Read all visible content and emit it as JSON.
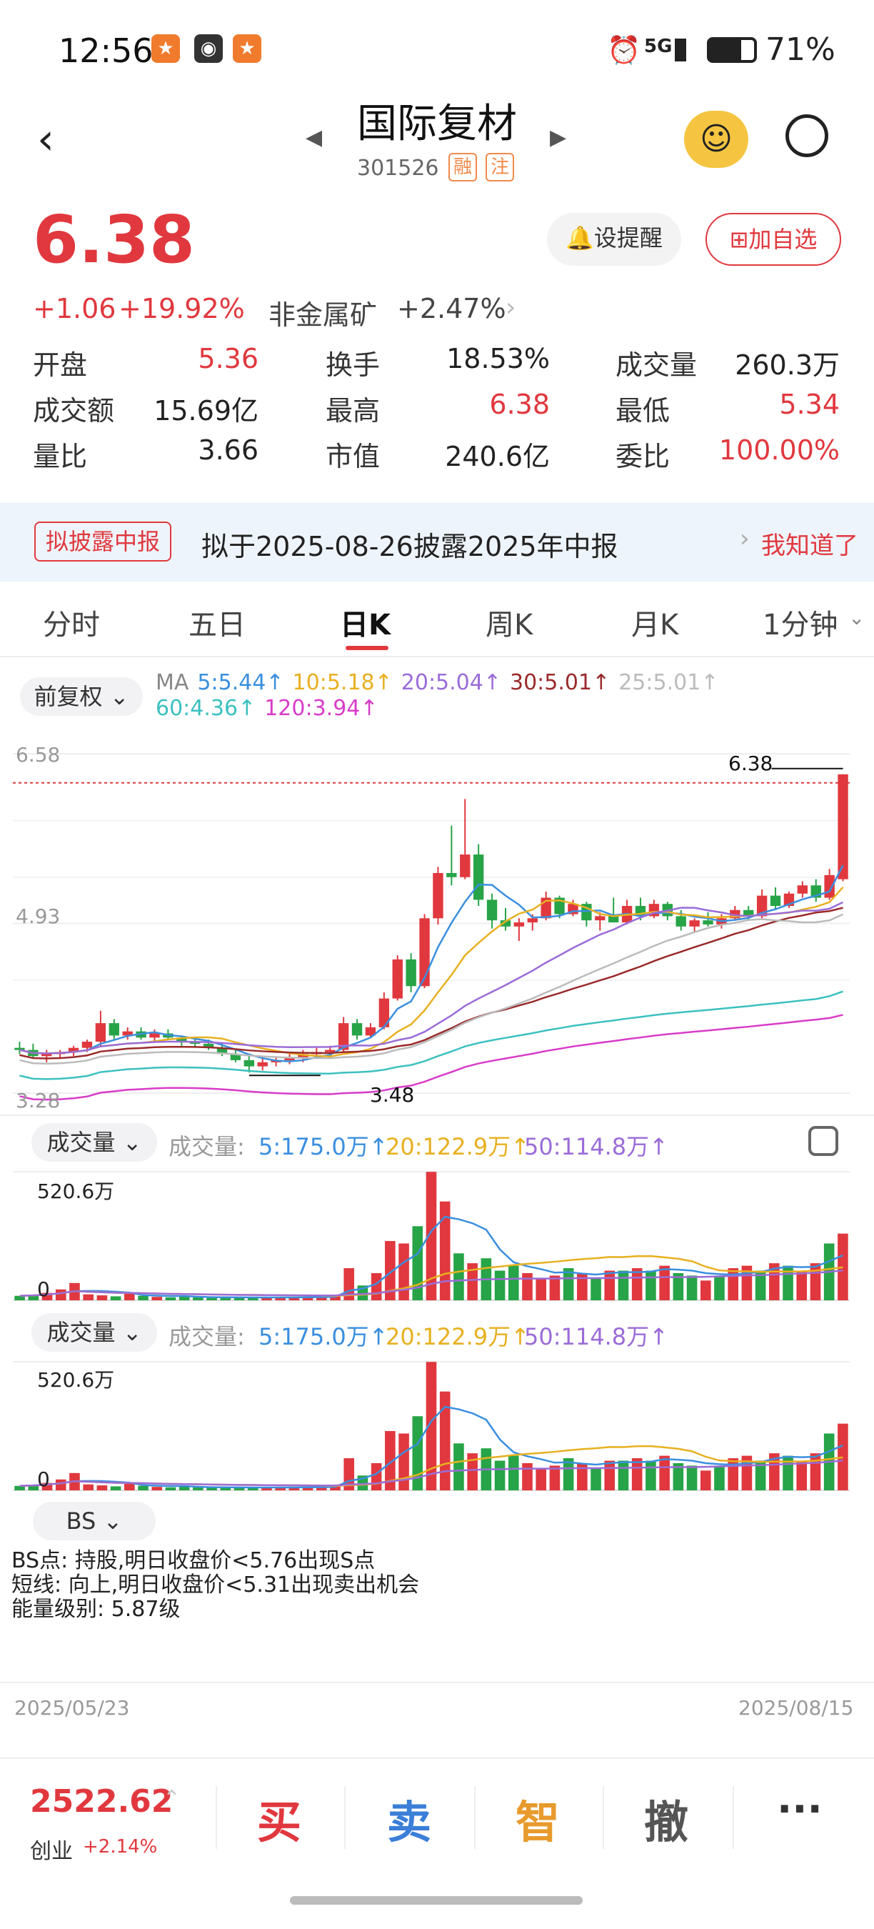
{
  "status": {
    "time": "12:56",
    "battery": "71%",
    "signal": "5G"
  },
  "header": {
    "title": "国际复材",
    "code": "301526",
    "tag1": "融",
    "tag2": "注"
  },
  "quote": {
    "price": "6.38",
    "change": "+1.06",
    "change_pct": "+19.92%",
    "sector": "非金属矿",
    "sector_pct": "+2.47%",
    "alert_btn": "设提醒",
    "watch_btn": "加自选",
    "rows": [
      [
        {
          "l": "开盘",
          "v": "5.36"
        },
        {
          "l": "换手",
          "v": "18.53%"
        },
        {
          "l": "成交量",
          "v": "260.3万"
        }
      ],
      [
        {
          "l": "成交额",
          "v": "15.69亿"
        },
        {
          "l": "最高",
          "v": "6.38"
        },
        {
          "l": "最低",
          "v": "5.34"
        }
      ],
      [
        {
          "l": "量比",
          "v": "3.66"
        },
        {
          "l": "市值",
          "v": "240.6亿"
        },
        {
          "l": "委比",
          "v": "100.00%"
        }
      ]
    ]
  },
  "banner": {
    "tag": "拟披露中报",
    "text": "拟于2025-08-26披露2025年中报",
    "action": "我知道了"
  },
  "tabs": [
    "分时",
    "五日",
    "日K",
    "周K",
    "月K",
    "1分钟"
  ],
  "ma": {
    "mode": "前复权",
    "items": [
      {
        "t": "MA",
        "c": "#888"
      },
      {
        "t": "5:5.44↑",
        "c": "#3b8fde"
      },
      {
        "t": "10:5.18↑",
        "c": "#e8b020"
      },
      {
        "t": "20:5.04↑",
        "c": "#9b6cd8"
      },
      {
        "t": "30:5.01↑",
        "c": "#9a2b2b"
      },
      {
        "t": "25:5.01↑",
        "c": "#bbbbbb"
      },
      {
        "t": "60:4.36↑",
        "c": "#3cc0c0"
      },
      {
        "t": "120:3.94↑",
        "c": "#d83cc8"
      }
    ]
  },
  "chart": {
    "top_label": "6.58",
    "mid_label": "4.93",
    "low_label": "3.28",
    "hi_mark": "6.38",
    "lo_mark": "3.48",
    "ylim": [
      3.28,
      6.58
    ],
    "candles": [
      [
        3.72,
        3.78,
        3.66,
        3.7
      ],
      [
        3.7,
        3.76,
        3.62,
        3.64
      ],
      [
        3.64,
        3.7,
        3.58,
        3.66
      ],
      [
        3.66,
        3.7,
        3.62,
        3.68
      ],
      [
        3.68,
        3.74,
        3.64,
        3.72
      ],
      [
        3.72,
        3.8,
        3.68,
        3.78
      ],
      [
        3.78,
        4.08,
        3.74,
        3.96
      ],
      [
        3.96,
        4.0,
        3.8,
        3.84
      ],
      [
        3.84,
        3.92,
        3.8,
        3.88
      ],
      [
        3.88,
        3.92,
        3.8,
        3.82
      ],
      [
        3.82,
        3.9,
        3.78,
        3.86
      ],
      [
        3.86,
        3.9,
        3.8,
        3.82
      ],
      [
        3.82,
        3.84,
        3.74,
        3.78
      ],
      [
        3.78,
        3.82,
        3.72,
        3.76
      ],
      [
        3.76,
        3.8,
        3.7,
        3.72
      ],
      [
        3.72,
        3.76,
        3.64,
        3.66
      ],
      [
        3.66,
        3.7,
        3.58,
        3.6
      ],
      [
        3.6,
        3.64,
        3.48,
        3.54
      ],
      [
        3.54,
        3.62,
        3.5,
        3.58
      ],
      [
        3.58,
        3.64,
        3.54,
        3.6
      ],
      [
        3.6,
        3.66,
        3.56,
        3.62
      ],
      [
        3.62,
        3.7,
        3.58,
        3.66
      ],
      [
        3.66,
        3.72,
        3.62,
        3.68
      ],
      [
        3.68,
        3.74,
        3.62,
        3.7
      ],
      [
        3.7,
        4.02,
        3.68,
        3.96
      ],
      [
        3.96,
        4.0,
        3.8,
        3.84
      ],
      [
        3.84,
        3.96,
        3.82,
        3.92
      ],
      [
        3.92,
        4.26,
        3.9,
        4.2
      ],
      [
        4.2,
        4.62,
        4.18,
        4.58
      ],
      [
        4.58,
        4.64,
        4.26,
        4.32
      ],
      [
        4.32,
        5.02,
        4.3,
        4.98
      ],
      [
        4.98,
        5.48,
        4.92,
        5.42
      ],
      [
        5.42,
        5.88,
        5.3,
        5.38
      ],
      [
        5.38,
        6.14,
        5.36,
        5.6
      ],
      [
        5.6,
        5.7,
        5.1,
        5.16
      ],
      [
        5.16,
        5.22,
        4.88,
        4.96
      ],
      [
        4.96,
        5.08,
        4.86,
        4.9
      ],
      [
        4.9,
        4.98,
        4.76,
        4.94
      ],
      [
        4.94,
        5.02,
        4.86,
        4.98
      ],
      [
        4.98,
        5.24,
        4.96,
        5.18
      ],
      [
        5.18,
        5.2,
        4.98,
        5.02
      ],
      [
        5.02,
        5.16,
        5.0,
        5.12
      ],
      [
        5.12,
        5.14,
        4.9,
        4.96
      ],
      [
        4.96,
        5.04,
        4.86,
        5.0
      ],
      [
        5.0,
        5.18,
        4.96,
        4.94
      ],
      [
        4.94,
        5.16,
        4.92,
        5.1
      ],
      [
        5.1,
        5.18,
        4.96,
        5.0
      ],
      [
        5.0,
        5.16,
        4.98,
        5.12
      ],
      [
        5.12,
        5.14,
        4.96,
        5.0
      ],
      [
        5.0,
        5.06,
        4.86,
        4.9
      ],
      [
        4.9,
        4.98,
        4.84,
        4.96
      ],
      [
        4.96,
        5.04,
        4.9,
        4.92
      ],
      [
        4.92,
        5.02,
        4.88,
        4.98
      ],
      [
        4.98,
        5.1,
        4.96,
        5.06
      ],
      [
        5.06,
        5.1,
        4.96,
        5.0
      ],
      [
        5.0,
        5.26,
        4.98,
        5.2
      ],
      [
        5.2,
        5.28,
        5.06,
        5.1
      ],
      [
        5.1,
        5.24,
        5.08,
        5.22
      ],
      [
        5.22,
        5.34,
        5.18,
        5.3
      ],
      [
        5.3,
        5.36,
        5.14,
        5.18
      ],
      [
        5.18,
        5.46,
        5.16,
        5.4
      ],
      [
        5.36,
        6.38,
        5.34,
        6.38
      ]
    ]
  },
  "volume": {
    "label": "成交量",
    "ma_label": "成交量:",
    "ma5": "5:175.0万↑",
    "ma20": "20:122.9万↑",
    "ma50": "50:114.8万↑",
    "max_label": "520.6万",
    "zero": "0",
    "max": 520.6,
    "bars": [
      18,
      22,
      30,
      44,
      70,
      24,
      20,
      16,
      26,
      18,
      14,
      12,
      16,
      12,
      10,
      12,
      10,
      14,
      12,
      10,
      12,
      14,
      16,
      18,
      130,
      60,
      110,
      240,
      230,
      300,
      520,
      400,
      190,
      150,
      170,
      120,
      140,
      110,
      90,
      100,
      130,
      110,
      90,
      120,
      120,
      130,
      120,
      140,
      110,
      100,
      80,
      100,
      130,
      140,
      120,
      150,
      140,
      120,
      150,
      230,
      270
    ]
  },
  "bs": {
    "label": "BS",
    "lines": [
      "BS点: 持股,明日收盘价<5.76出现S点",
      "短线: 向上,明日收盘价<5.31出现卖出机会",
      "能量级别: 5.87级"
    ]
  },
  "dates": {
    "start": "2025/05/23",
    "end": "2025/08/15"
  },
  "bottom": {
    "index": "2522.62",
    "index_name": "创业",
    "index_pct": "+2.14%",
    "buy": "买",
    "sell": "卖",
    "smart": "智",
    "cancel": "撤",
    "more": "···"
  },
  "colors": {
    "up": "#e0383e",
    "down": "#27a447"
  }
}
